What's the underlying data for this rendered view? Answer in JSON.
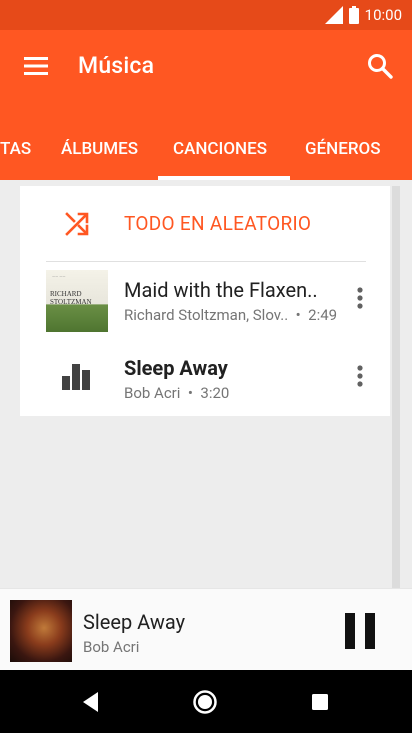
{
  "status_bar": {
    "time": "10:00",
    "icons": [
      "cell-signal-icon",
      "battery-icon"
    ]
  },
  "app_bar": {
    "title": "Música",
    "icons": [
      "menu-icon",
      "search-icon"
    ]
  },
  "tabs": [
    {
      "label": "TAS",
      "active": false
    },
    {
      "label": "ÁLBUMES",
      "active": false
    },
    {
      "label": "CANCIONES",
      "active": true
    },
    {
      "label": "GÉNEROS",
      "active": false
    }
  ],
  "shuffle": {
    "label": "TODO EN ALEATORIO",
    "icon": "shuffle-icon"
  },
  "songs": [
    {
      "title": "Maid with the Flaxen..",
      "artist": "Richard Stoltzman, Slov..",
      "duration": "2:49",
      "art_text_line1": "RICHARD",
      "art_text_line2": "STOLTZMAN"
    },
    {
      "title": "Sleep Away",
      "artist": "Bob Acri",
      "duration": "3:20",
      "icon": "equalizer-bars-icon"
    }
  ],
  "now_playing": {
    "title": "Sleep Away",
    "artist": "Bob Acri",
    "control_icon": "pause-icon"
  },
  "colors": {
    "status_bar": "#e64a19",
    "primary": "#ff5722",
    "accent_text": "#ff5722"
  }
}
